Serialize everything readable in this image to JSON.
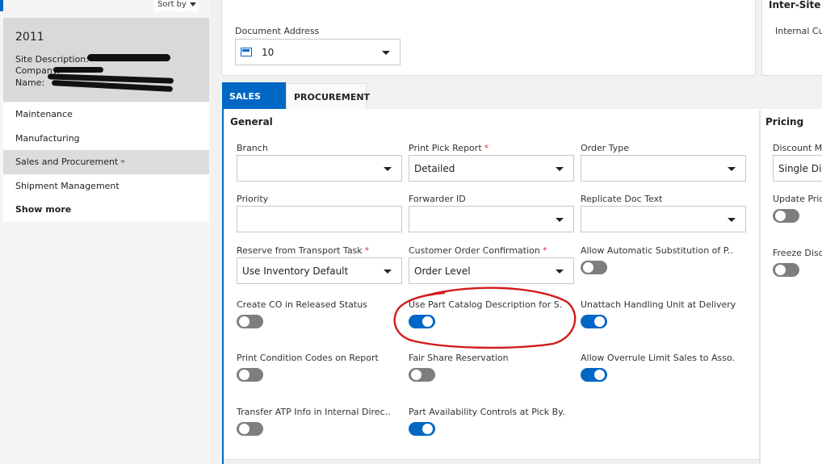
{
  "left": {
    "sort_label": "Sort by",
    "site": {
      "id": "2011",
      "description_label": "Site Description:",
      "company_label": "Company:",
      "name_label": "Name:"
    },
    "nav": [
      {
        "label": "Maintenance"
      },
      {
        "label": "Manufacturing"
      },
      {
        "label": "Sales and Procurement"
      },
      {
        "label": "Shipment Management"
      },
      {
        "label": "Show more"
      }
    ]
  },
  "top": {
    "document_address_label": "Document Address",
    "document_address_value": "10",
    "inter_site_title": "Inter-Site",
    "internal_label": "Internal Cu"
  },
  "tabs": [
    {
      "label": "SALES"
    },
    {
      "label": "PROCUREMENT"
    }
  ],
  "general": {
    "title": "General",
    "branch_label": "Branch",
    "branch_value": "",
    "print_pick_label": "Print Pick Report",
    "print_pick_value": "Detailed",
    "order_type_label": "Order Type",
    "order_type_value": "",
    "priority_label": "Priority",
    "priority_value": "",
    "forwarder_label": "Forwarder ID",
    "forwarder_value": "",
    "replicate_label": "Replicate Doc Text",
    "replicate_value": "",
    "reserve_label": "Reserve from Transport Task",
    "reserve_value": "Use Inventory Default",
    "coc_label": "Customer Order Confirmation",
    "coc_value": "Order Level",
    "allow_auto_label": "Allow Automatic Substitution of P...",
    "create_co_label": "Create CO in Released Status",
    "use_part_label": "Use Part Catalog Description for S...",
    "unattach_label": "Unattach Handling Unit at Delivery",
    "print_cond_label": "Print Condition Codes on Report",
    "fair_share_label": "Fair Share Reservation",
    "allow_overrule_label": "Allow Overrule Limit Sales to Asso...",
    "transfer_atp_label": "Transfer ATP Info in Internal Direc...",
    "part_avail_label": "Part Availability Controls at Pick By...",
    "required_mark": "*"
  },
  "pricing": {
    "title": "Pricing",
    "discount_label": "Discount Me",
    "discount_value": "Single Disc",
    "update_label": "Update Pric",
    "freeze_label": "Freeze Disco"
  },
  "colors": {
    "accent": "#0067c5",
    "annotation": "#d01c1c"
  },
  "toggles": {
    "allow_auto": false,
    "create_co": false,
    "use_part": true,
    "unattach": true,
    "print_cond": false,
    "fair_share": false,
    "allow_overrule": true,
    "transfer_atp": false,
    "part_avail": true,
    "update_price": false,
    "freeze_disc": false
  }
}
